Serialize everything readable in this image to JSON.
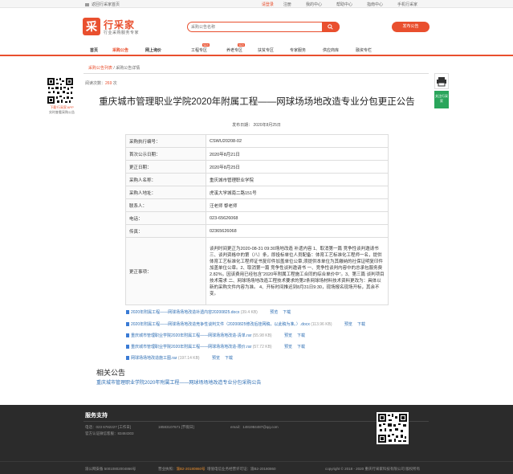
{
  "topbar": {
    "home": "返回行采家首页",
    "welcome": "请登录",
    "register": "注册",
    "my_center": "我的中心",
    "help": "帮助中心",
    "guide": "指南中心",
    "mobile": "手机行采家"
  },
  "logo": {
    "mark": "采",
    "name": "行采家",
    "slogan": "行业采购服务专家"
  },
  "search": {
    "placeholder": "采购公告名称"
  },
  "publish_button": "发布公告",
  "nav": {
    "items": [
      {
        "label": "首页",
        "hot": ""
      },
      {
        "label": "采购公告",
        "hot": ""
      },
      {
        "label": "网上询价",
        "hot": ""
      },
      {
        "label": "工程专区",
        "hot": "NEW"
      },
      {
        "label": "养老专区",
        "hot": "NEW"
      },
      {
        "label": "扶贫专区",
        "hot": ""
      },
      {
        "label": "专家服务",
        "hot": ""
      },
      {
        "label": "供应商库",
        "hot": ""
      },
      {
        "label": "融资专栏",
        "hot": ""
      }
    ]
  },
  "breadcrumb": {
    "link": "采购公告列表",
    "sep": " / ",
    "current": "采购公告详情"
  },
  "left_qr": {
    "line1": "下载'行采家'APP",
    "line2": "实时查看采购公告"
  },
  "views": {
    "label": "阅读次数：",
    "value": "269",
    "unit": " 次"
  },
  "title": "重庆城市管理职业学院2020年附属工程——网球场场地改造专业分包更正公告",
  "pubdate": "发布日期：  2020年8月25日",
  "info_rows": [
    {
      "key": "采购执行编号：",
      "value": "CSWU20208-02"
    },
    {
      "key": "首次公示日期：",
      "value": "2020年8月21日"
    },
    {
      "key": "更正日期：",
      "value": "2020年8月25日"
    },
    {
      "key": "采购人名称：",
      "value": "重庆城市管理职业学院"
    },
    {
      "key": "采购人地址：",
      "value": "虎溪大学城南二路151号"
    },
    {
      "key": "联系人：",
      "value": "汪老师 黎老师"
    },
    {
      "key": "电话：",
      "value": "023-65626068"
    },
    {
      "key": "传真：",
      "value": "02365626068"
    }
  ],
  "correction": {
    "key": "更正事项：",
    "value": "谈判时间更正为2020-08-31 09:30场地改造 补遗内容 1、取消第一篇 竞争性谈判邀请书 三、谈判资格中的第（八）条，即投标单位人员配备：体育工艺标准化工程师一名，提供体育工艺标准化工程师证书复印件加盖单位公章,须提供本单位为其缴纳的社保证明复印件加盖单位公章。2、取消第一篇 竞争性谈判邀请书 一、竞争性谈判内容中的总承包服务费2.82%，因该费用已经包含“2020年附属工程施工合同的综合单价中”。3、第三篇 谈判项目技术需求 二、网球场场地改造工程技术要求的第2条网球场材料技术资料更改为：具体以新的采购文件内容为准。 4、开标时间推迟到8月31日9:30，现场报名现场开标，其余不变。"
  },
  "attachments": [
    {
      "name": "2020年附属工程——网球场场地改造补遗内容20200825.docx",
      "size": "(39.4 KB)"
    },
    {
      "name": "2020年附属工程——网球场场地改造竞争性谈判文件（20200825修改后挂网稿，以此稿为准。）.docx",
      "size": "(113.96 KB)"
    },
    {
      "name": "重庆城市管理职业学院2020年附属工程——网球场场地改造-清单.rar",
      "size": "(55.98 KB)"
    },
    {
      "name": "重庆城市管理职业学院2020年附属工程——网球场场地改造-限价.rar",
      "size": "(57.72 KB)"
    },
    {
      "name": "网球场场地改造施工图.rar",
      "size": "(197.14 KB)"
    }
  ],
  "attachment_ops": {
    "preview": "预览",
    "download": "下载"
  },
  "related": {
    "title": "相关公告",
    "link": "重庆城市管理职业学院2020年附属工程——网球场场地改造专业分包采购公告"
  },
  "right_tools": {
    "follow": "关注行采家"
  },
  "footer": {
    "title": "服务支持",
    "tel": "电话：023 6782227 [工作日]",
    "tel2": "18583107671 [节假日]",
    "email": "email：1481984487@qq.com",
    "service": "官方认证微信客服：83484303",
    "icp": "渝公网安备 50010802004866号",
    "license_prefix": "营业执照：",
    "license": "渝B2-20180860号",
    "cert": "增值电信业务经营许可证：渝B2-20180860",
    "copyright": "copyright © 2018 - 2020 重庆行采家科技有限公司 版权所有"
  },
  "colors": {
    "brand": "#e94f2e",
    "link": "#2c6db3",
    "footer_bg": "#2b2b2b"
  }
}
